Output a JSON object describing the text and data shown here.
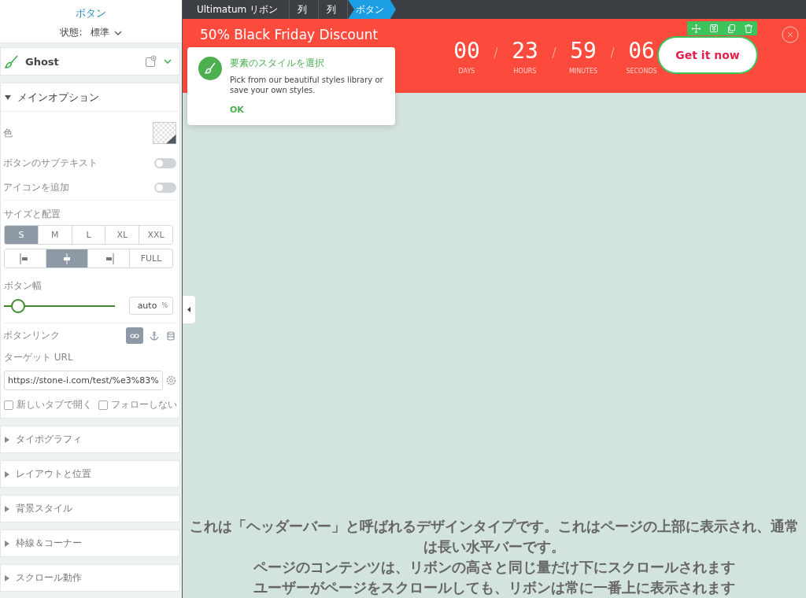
{
  "sidebar": {
    "title": "ボタン",
    "state_label": "状態:",
    "state_value": "標準",
    "style_preset": {
      "name": "Ghost"
    },
    "main_options": {
      "title": "メインオプション",
      "expanded": true,
      "color_label": "色",
      "toggles": [
        {
          "label": "ボタンのサブテキスト",
          "on": false
        },
        {
          "label": "アイコンを追加",
          "on": false
        }
      ],
      "size_label": "サイズと配置",
      "sizes": [
        {
          "label": "S",
          "selected": true
        },
        {
          "label": "M",
          "selected": false
        },
        {
          "label": "L",
          "selected": false
        },
        {
          "label": "XL",
          "selected": false
        },
        {
          "label": "XXL",
          "selected": false
        }
      ],
      "alignments": [
        {
          "kind": "left",
          "selected": false
        },
        {
          "kind": "center",
          "selected": true
        },
        {
          "kind": "right",
          "selected": false
        },
        {
          "kind": "full",
          "label": "FULL",
          "selected": false
        }
      ],
      "width_label": "ボタン幅",
      "width_slider": {
        "level": 0.12
      },
      "width_value": "auto",
      "width_unit": "%",
      "link_label": "ボタンリンク",
      "link_types": [
        {
          "kind": "link",
          "selected": true
        },
        {
          "kind": "anchor",
          "selected": false
        },
        {
          "kind": "database",
          "selected": false
        }
      ],
      "url_label": "ターゲット URL",
      "url_value": "https://stone-i.com/test/%e3%83%",
      "checkboxes": [
        {
          "label": "新しいタブで開く",
          "checked": false
        },
        {
          "label": "フォローしない",
          "checked": false
        }
      ]
    },
    "sections": [
      {
        "title": "タイポグラフィ",
        "expanded": false
      },
      {
        "title": "レイアウトと位置",
        "expanded": false
      },
      {
        "title": "背景スタイル",
        "expanded": false
      },
      {
        "title": "枠線＆コーナー",
        "expanded": false
      },
      {
        "title": "スクロール動作",
        "expanded": false
      }
    ]
  },
  "breadcrumbs": [
    {
      "label": "Ultimatum リボン",
      "selected": false
    },
    {
      "label": "列",
      "selected": false
    },
    {
      "label": "列",
      "selected": false
    },
    {
      "label": "ボタン",
      "selected": true
    }
  ],
  "ribbon": {
    "headline": "50% Black Friday Discount",
    "countdown": [
      {
        "value": "00",
        "unit": "DAYS"
      },
      {
        "value": "23",
        "unit": "HOURS"
      },
      {
        "value": "59",
        "unit": "MINUTES"
      },
      {
        "value": "06",
        "unit": "SECONDS"
      }
    ],
    "button": "Get it now"
  },
  "popover": {
    "title": "要素のスタイルを選択",
    "body": "Pick from our beautiful styles library or save your own styles.",
    "action": "OK"
  },
  "page_text": [
    "これは「ヘッダーバー」と呼ばれるデザインタイプです。これはページの上部に表示され、通常は長い水平バーです。",
    "ページのコンテンツは、リボンの高さと同じ量だけ下にスクロールされます",
    "ユーザーがページをスクロールしても、リボンは常に一番上に表示されます"
  ]
}
